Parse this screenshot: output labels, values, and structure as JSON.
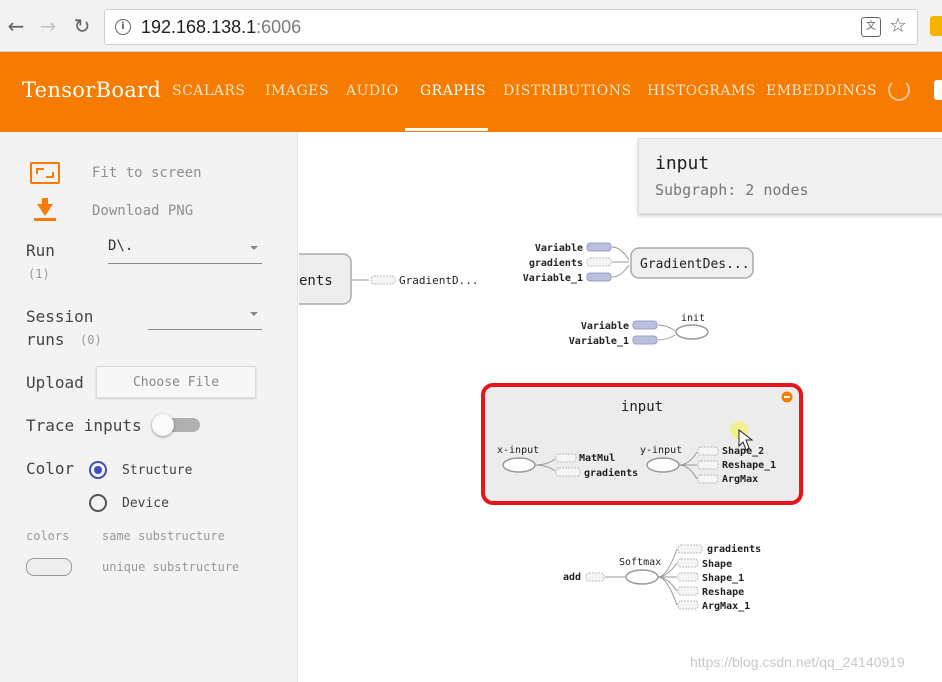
{
  "browser": {
    "back_icon": "←",
    "forward_icon": "→",
    "reload_icon": "↻",
    "url_host": "192.168.138.1",
    "url_port": ":6006",
    "info_icon": "i",
    "translate_icon": "文",
    "star_icon": "☆"
  },
  "header": {
    "title": "TensorBoard",
    "tabs": [
      "SCALARS",
      "IMAGES",
      "AUDIO",
      "GRAPHS",
      "DISTRIBUTIONS",
      "HISTOGRAMS",
      "EMBEDDINGS"
    ],
    "active_tab": "GRAPHS",
    "accent_color": "#f57c00"
  },
  "sidebar": {
    "fit_to_screen": "Fit to screen",
    "download_png": "Download PNG",
    "run_label": "Run",
    "run_count": "(1)",
    "run_value": "D\\.",
    "session_label_1": "Session",
    "session_label_2": "runs",
    "session_count": "(0)",
    "session_value": "",
    "upload_label": "Upload",
    "choose_file": "Choose File",
    "trace_inputs": "Trace inputs",
    "trace_inputs_on": false,
    "color_label": "Color",
    "color_options": [
      "Structure",
      "Device"
    ],
    "color_selected": "Structure",
    "colors_label": "colors",
    "same_substructure": "same substructure",
    "unique_substructure": "unique substructure"
  },
  "info_card": {
    "title": "input",
    "subtitle": "Subgraph: 2 nodes"
  },
  "graph": {
    "clipped_node": "ents",
    "clipped_edge_label": "GradientD...",
    "gd_node": "GradientDes...",
    "gd_inputs": [
      "Variable",
      "gradients",
      "Variable_1"
    ],
    "init_node": "init",
    "init_inputs": [
      "Variable",
      "Variable_1"
    ],
    "input_group": {
      "title": "input",
      "x_input": "x-input",
      "x_outputs": [
        "MatMul",
        "gradients"
      ],
      "y_input": "y-input",
      "y_outputs": [
        "Shape_2",
        "Reshape_1",
        "ArgMax"
      ],
      "highlight_color": "#e8141c"
    },
    "softmax_node": "Softmax",
    "softmax_input": "add",
    "softmax_outputs": [
      "gradients",
      "Shape",
      "Shape_1",
      "Reshape",
      "ArgMax_1"
    ]
  },
  "watermark": "https://blog.csdn.net/qq_24140919"
}
